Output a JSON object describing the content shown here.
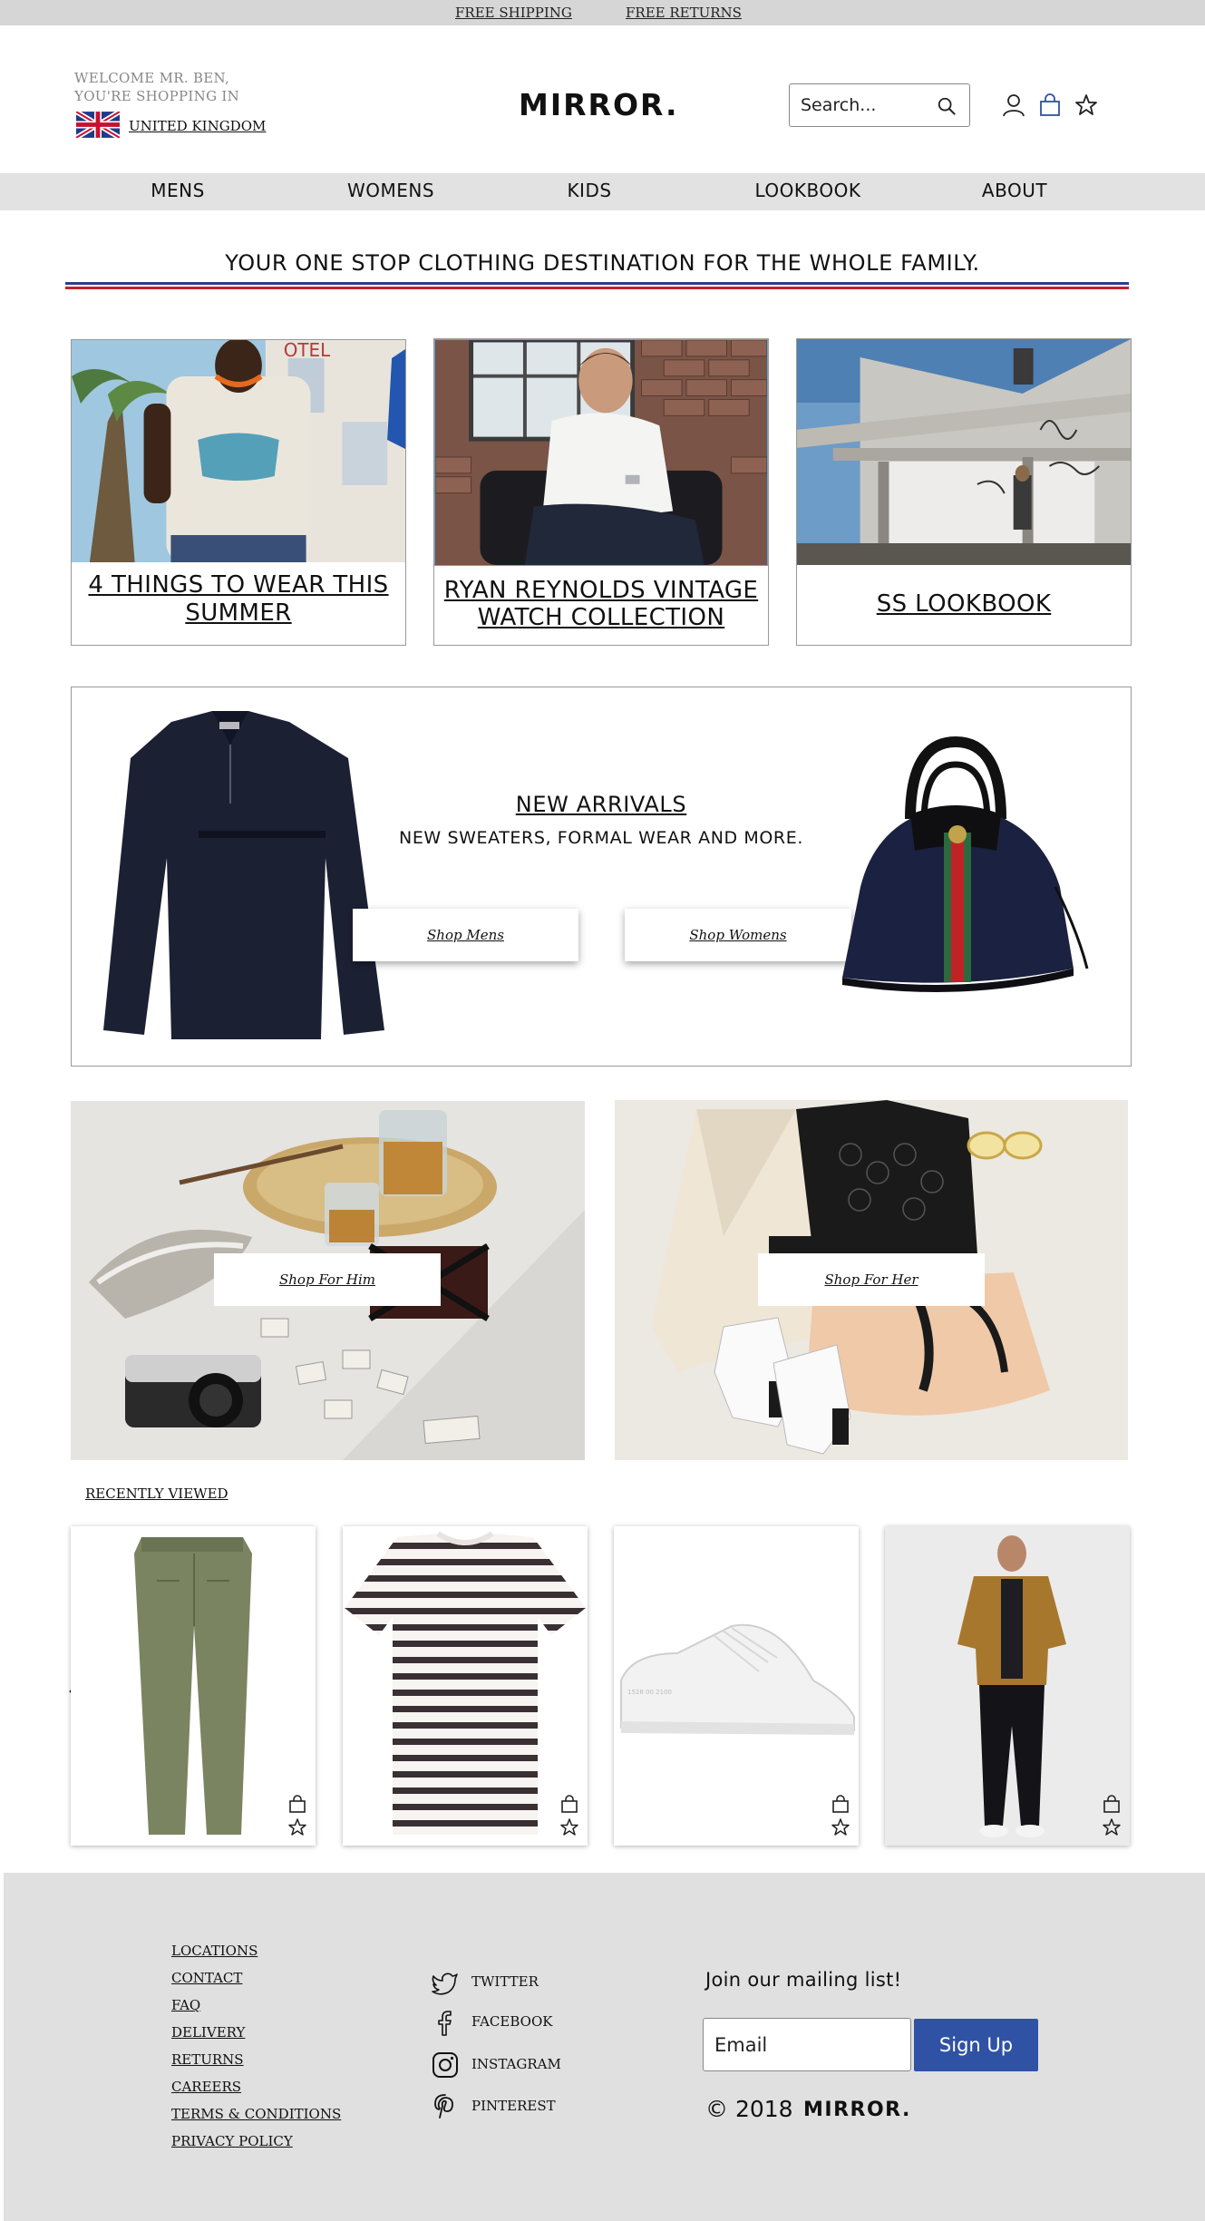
{
  "promo": {
    "shipping": "FREE SHIPPING",
    "returns": "FREE RETURNS"
  },
  "header": {
    "welcome_line1": "WELCOME MR. BEN,",
    "welcome_line2": "YOU'RE SHOPPING IN",
    "country": "UNITED KINGDOM",
    "logo": "MIRROR.",
    "search_placeholder": "Search...",
    "icons": [
      "search-icon",
      "account-icon",
      "bag-icon",
      "star-icon"
    ]
  },
  "nav": {
    "items": [
      "MENS",
      "WOMENS",
      "KIDS",
      "LOOKBOOK",
      "ABOUT"
    ]
  },
  "tagline": "YOUR ONE STOP CLOTHING DESTINATION FOR THE WHOLE FAMILY.",
  "features": [
    {
      "line1": "4 THINGS TO WEAR THIS",
      "line2": "SUMMER"
    },
    {
      "line1": "RYAN REYNOLDS VINTAGE",
      "line2": "WATCH COLLECTION"
    },
    {
      "line1": "SS LOOKBOOK",
      "line2": ""
    }
  ],
  "arrivals": {
    "title": "NEW ARRIVALS",
    "subtitle": "NEW SWEATERS, FORMAL WEAR AND MORE.",
    "shop_mens": "Shop Mens",
    "shop_womens": "Shop Womens"
  },
  "gifts": {
    "him": "Shop For Him",
    "her": "Shop For Her"
  },
  "recently_viewed": {
    "title": "RECENTLY VIEWED",
    "items": [
      "trousers",
      "striped-tshirt",
      "sneakers",
      "model-outfit"
    ]
  },
  "footer": {
    "links": [
      "LOCATIONS",
      "CONTACT",
      "FAQ",
      "DELIVERY",
      "RETURNS",
      "CAREERS",
      "TERMS & CONDITIONS",
      "PRIVACY POLICY"
    ],
    "social": [
      "TWITTER",
      "FACEBOOK",
      "INSTAGRAM",
      "PINTEREST"
    ],
    "mailing_title": "Join our mailing list!",
    "email_placeholder": "Email",
    "signup": "Sign Up",
    "copyright": "© 2018",
    "logo": "MIRROR."
  },
  "colors": {
    "accent_blue": "#2f52a4",
    "stripe_blue": "#2b3f8f",
    "stripe_red": "#c0242a",
    "nav_bg": "#e2e2e2",
    "footer_bg": "#e0e0e0"
  }
}
